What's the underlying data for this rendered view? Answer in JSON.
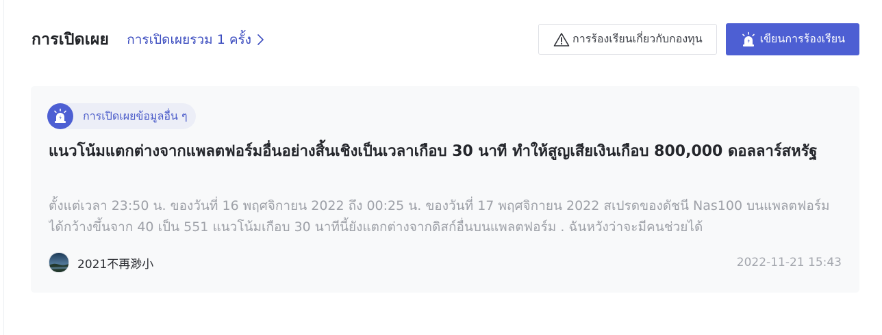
{
  "header": {
    "title": "การเปิดเผย",
    "summary_link": "การเปิดเผยรวม 1 ครั้ง"
  },
  "actions": {
    "complaint_label": "การร้องเรียนเกี่ยวกับกองทุน",
    "write_label": "เขียนการร้องเรียน"
  },
  "card": {
    "tag_label": "การเปิดเผยข้อมูลอื่น ๆ",
    "title": "แนวโน้มแตกต่างจากแพลตฟอร์มอื่นอย่างสิ้นเชิงเป็นเวลาเกือบ 30 นาที ทำให้สูญเสียเงินเกือบ 800,000 ดอลลาร์สหรัฐ",
    "excerpt": "ตั้งแต่เวลา 23:50 น. ของวันที่ 16 พฤศจิกายน 2022 ถึง 00:25 น. ของวันที่ 17 พฤศจิกายน 2022 สเปรดของดัชนี Nas100 บนแพลตฟอร์มได้กว้างขึ้นจาก 40 เป็น 551 แนวโน้มเกือบ 30 นาทีนี้ยังแตกต่างจากดิสก์อื่นบนแพลตฟอร์ม . ฉันหวังว่าจะมีคนช่วยได้",
    "author": "2021不再渺小",
    "timestamp": "2022-11-21 15:43"
  },
  "colors": {
    "accent": "#4d5fd3",
    "link": "#3a4bbf",
    "card_bg": "#f8f9fa",
    "muted_text": "#9ea1a8"
  },
  "icons": {
    "summary_chevron": "chevron-right-icon",
    "complaint": "warning-triangle-icon",
    "write": "alarm-siren-icon",
    "tag": "alarm-siren-icon",
    "avatar": "avatar-image"
  }
}
